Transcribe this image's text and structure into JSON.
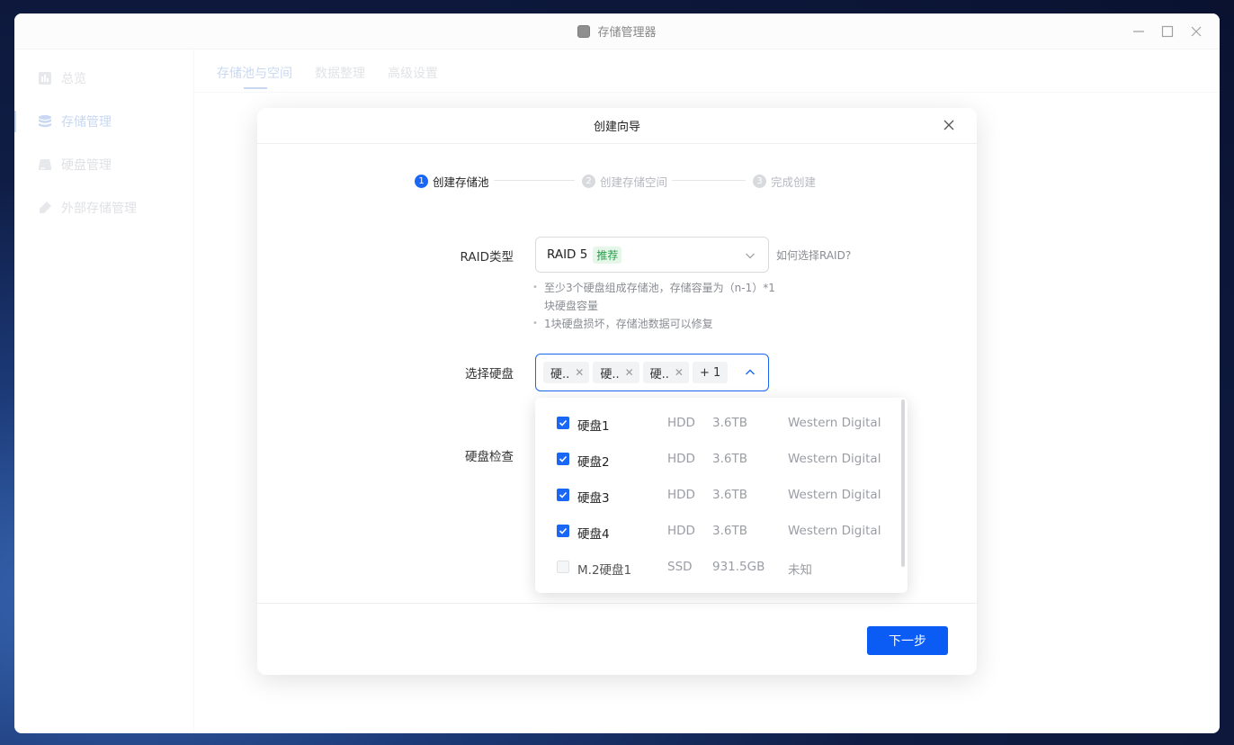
{
  "window": {
    "title": "存储管理器"
  },
  "sidebar": {
    "items": [
      {
        "label": "总览",
        "icon": "chart-icon"
      },
      {
        "label": "存储管理",
        "icon": "database-icon"
      },
      {
        "label": "硬盘管理",
        "icon": "disk-icon"
      },
      {
        "label": "外部存储管理",
        "icon": "usb-drive-icon"
      }
    ],
    "active_index": 1
  },
  "tabs": [
    {
      "label": "存储池与空间"
    },
    {
      "label": "数据整理"
    },
    {
      "label": "高级设置"
    }
  ],
  "dialog": {
    "title": "创建向导",
    "steps": [
      {
        "num": "1",
        "label": "创建存储池"
      },
      {
        "num": "2",
        "label": "创建存储空间"
      },
      {
        "num": "3",
        "label": "完成创建"
      }
    ],
    "raid_label": "RAID类型",
    "raid_value": "RAID 5",
    "raid_badge": "推荐",
    "raid_help": "如何选择RAID?",
    "hints": [
      "至少3个硬盘组成存储池，存储容量为（n-1）*1块硬盘容量",
      "1块硬盘损坏，存储池数据可以修复"
    ],
    "disk_select_label": "选择硬盘",
    "chips": [
      "硬..",
      "硬..",
      "硬.."
    ],
    "chips_more": "+ 1",
    "disk_check_label": "硬盘检查",
    "next_button": "下一步"
  },
  "disk_options": [
    {
      "name": "硬盘1",
      "type": "HDD",
      "size": "3.6TB",
      "vendor": "Western Digital",
      "checked": true
    },
    {
      "name": "硬盘2",
      "type": "HDD",
      "size": "3.6TB",
      "vendor": "Western Digital",
      "checked": true
    },
    {
      "name": "硬盘3",
      "type": "HDD",
      "size": "3.6TB",
      "vendor": "Western Digital",
      "checked": true
    },
    {
      "name": "硬盘4",
      "type": "HDD",
      "size": "3.6TB",
      "vendor": "Western Digital",
      "checked": true
    },
    {
      "name": "M.2硬盘1",
      "type": "SSD",
      "size": "931.5GB",
      "vendor": "未知",
      "checked": false
    }
  ],
  "colors": {
    "accent": "#1a66f5",
    "badge_bg": "#e6f7ea",
    "badge_fg": "#23a14a"
  }
}
